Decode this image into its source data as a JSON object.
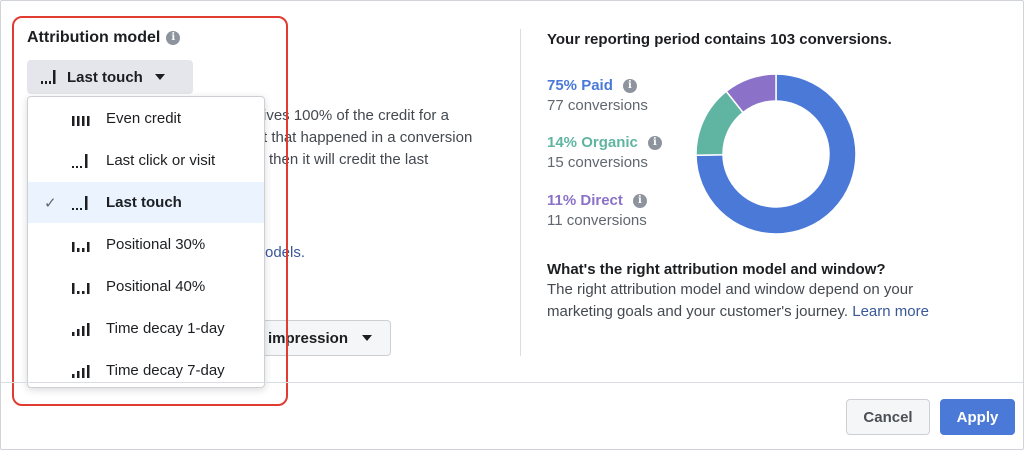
{
  "attribution": {
    "title": "Attribution model",
    "selected_label": "Last touch",
    "menu_items": [
      {
        "label": "Even credit",
        "icon": "even-credit-bars-icon",
        "selected": false
      },
      {
        "label": "Last click or visit",
        "icon": "last-click-bars-icon",
        "selected": false
      },
      {
        "label": "Last touch",
        "icon": "last-touch-bars-icon",
        "selected": true
      },
      {
        "label": "Positional 30%",
        "icon": "positional-30-bars-icon",
        "selected": false
      },
      {
        "label": "Positional 40%",
        "icon": "positional-40-bars-icon",
        "selected": false
      },
      {
        "label": "Time decay 1-day",
        "icon": "time-decay-1-bars-icon",
        "selected": false
      },
      {
        "label": "Time decay 7-day",
        "icon": "time-decay-7-bars-icon",
        "selected": false
      }
    ]
  },
  "behind": {
    "line1": "ives 100% of the credit for a",
    "line2": "t that happened in a conversion",
    "line3": "then it will credit the last",
    "link_fragment": "odels.",
    "window_label": "impression"
  },
  "summary": {
    "title": "Your reporting period contains 103 conversions.",
    "items": [
      {
        "label": "75% Paid",
        "sub": "77 conversions",
        "color": "#4a79d8",
        "value": 77
      },
      {
        "label": "14% Organic",
        "sub": "15 conversions",
        "color": "#5fb5a2",
        "value": 15
      },
      {
        "label": "11% Direct",
        "sub": "11 conversions",
        "color": "#8b72c8",
        "value": 11
      }
    ]
  },
  "help": {
    "title": "What's the right attribution model and window?",
    "body": "The right attribution model and window depend on your marketing goals and your customer's journey.",
    "link": "Learn more"
  },
  "footer": {
    "cancel": "Cancel",
    "apply": "Apply"
  }
}
